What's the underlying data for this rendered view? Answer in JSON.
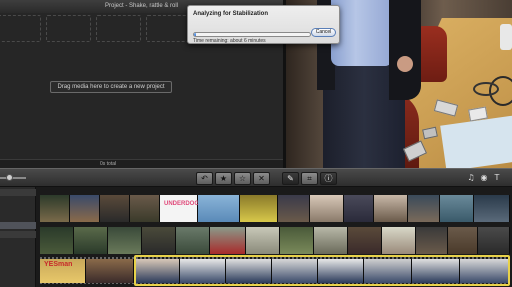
{
  "project": {
    "title": "Project - Shake, rattle & roll",
    "drag_hint": "Drag media here to create a new project",
    "total": "0s total"
  },
  "stabilization_dialog": {
    "title": "Analyzing for Stabilization",
    "progress_fraction": 0.02,
    "cancel_label": "Cancel",
    "time_remaining": "Time remaining: about 6 minutes"
  },
  "toolbar": {
    "buttons": [
      {
        "icon": "undo-icon",
        "glyph": "↶"
      },
      {
        "icon": "star-icon",
        "glyph": "★"
      },
      {
        "icon": "star-outline-icon",
        "glyph": "☆"
      },
      {
        "icon": "reject-icon",
        "glyph": "✕"
      },
      {
        "icon": "keyword-pen-icon",
        "glyph": "✎"
      },
      {
        "icon": "crop-icon",
        "glyph": "⌗"
      },
      {
        "icon": "info-icon",
        "glyph": "ⓘ"
      }
    ],
    "right_icons": [
      {
        "icon": "audio-icon",
        "glyph": "♫"
      },
      {
        "icon": "camera-icon",
        "glyph": "◉"
      },
      {
        "icon": "text-icon",
        "glyph": "T"
      }
    ]
  },
  "clips": {
    "row1_title": "UNDERDOG",
    "row3_title": "YESman"
  }
}
